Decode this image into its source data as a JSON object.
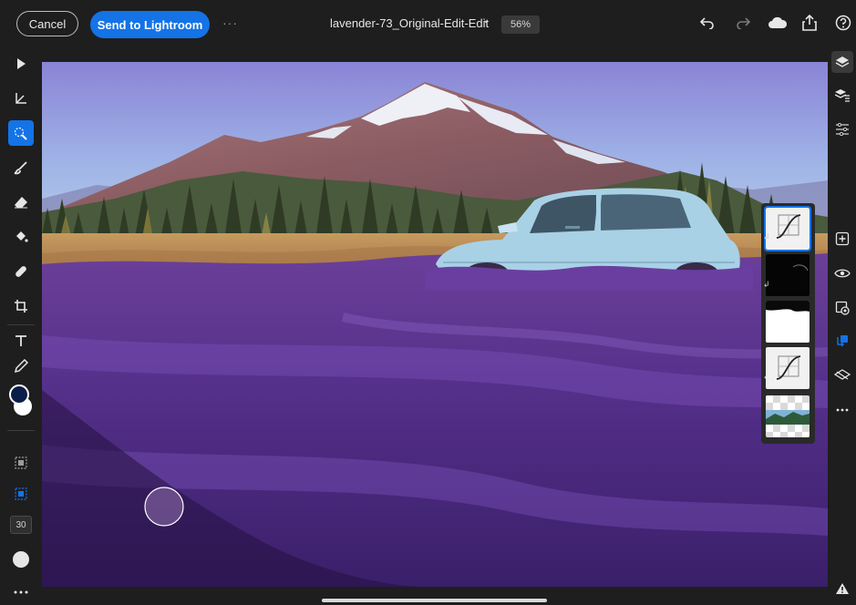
{
  "toolbar": {
    "cancel_label": "Cancel",
    "send_label": "Send to Lightroom",
    "more_label": "···",
    "doc_title": "lavender-73_Original-Edit-Edit",
    "doc_chevron": "⌄",
    "zoom": "56%"
  },
  "top_icons": [
    "undo-icon",
    "redo-icon",
    "cloud-icon",
    "share-icon",
    "help-icon"
  ],
  "left_tools": [
    "move",
    "select",
    "quick-selection",
    "brush",
    "eraser",
    "fill",
    "healing",
    "crop",
    "type",
    "eyedropper"
  ],
  "active_tool": "quick-selection",
  "brush_size": "30",
  "right_panel": [
    "layers",
    "layer-properties",
    "adjustments",
    "add-layer",
    "visibility",
    "mask",
    "clip",
    "more"
  ],
  "layers": [
    "curves-adjustment",
    "mask-black",
    "mask-white",
    "curves-adjustment-2",
    "photo-layer"
  ],
  "selected_layer": 0,
  "colors": {
    "accent": "#1473e6",
    "background": "#1e1e1e",
    "foreground_swatch": "#0b1e4a",
    "background_swatch": "#ffffff"
  }
}
